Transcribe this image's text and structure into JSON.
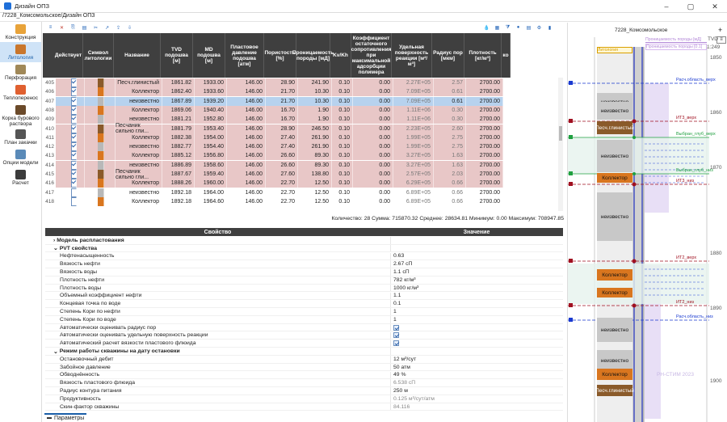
{
  "window": {
    "title": "Дизайн ОПЗ",
    "breadcrumb": "/7228_Комсомольское/Дизайн ОПЗ"
  },
  "sidebar": {
    "items": [
      {
        "label": "Конструкция",
        "icon": "construction-icon",
        "color": "#e8a33a"
      },
      {
        "label": "Литология",
        "icon": "lithology-icon",
        "color": "#c9762c",
        "active": true
      },
      {
        "label": "Перфорация",
        "icon": "perforation-icon",
        "color": "#a08858"
      },
      {
        "label": "Теплоперенос",
        "icon": "heat-transfer-icon",
        "color": "#e06030"
      },
      {
        "label": "Корка бурового раствора",
        "icon": "mud-cake-icon",
        "color": "#6b4a2a"
      },
      {
        "label": "План закачки",
        "icon": "injection-plan-icon",
        "color": "#555555"
      },
      {
        "label": "Опции модели",
        "icon": "model-options-icon",
        "color": "#5a8ab8"
      },
      {
        "label": "Расчет",
        "icon": "calculate-icon",
        "color": "#3c3c3c"
      }
    ]
  },
  "grid": {
    "columns": [
      "Действует",
      "Символ литологии",
      "Название",
      "TVD подошва [м]",
      "MD подошва [м]",
      "Пластовое давление подошва [атм]",
      "Пористость [%]",
      "Проницаемость породы [мД]",
      "Kv/Kh",
      "Коэффициент остаточного сопротивления при максимальной адсорбции полимера",
      "Удельная поверхность реакции [м²/м³]",
      "Радиус пор [мкм]",
      "Плотность [кг/м³]",
      "ко"
    ],
    "rows": [
      {
        "no": "405",
        "on": true,
        "sym": "#8a5a2a",
        "name": "Песч.глинистый",
        "tvd": "1861.82",
        "md": "1933.00",
        "p": "146.00",
        "por": "28.90",
        "perm": "241.90",
        "kv": "0.10",
        "koef": "0.00",
        "surf": "2.27E+05",
        "r": "2.57",
        "rdim": true,
        "dens": "2700.00",
        "bg": "#e8c7c7"
      },
      {
        "no": "406",
        "on": true,
        "sym": "#d9761f",
        "name": "Коллектор",
        "tvd": "1862.40",
        "md": "1933.60",
        "p": "146.00",
        "por": "21.70",
        "perm": "10.30",
        "kv": "0.10",
        "koef": "0.00",
        "surf": "7.09E+05",
        "r": "0.61",
        "rdim": true,
        "dens": "2700.00",
        "bg": "#e8c7c7"
      },
      {
        "no": "407",
        "on": true,
        "sym": "#b8b8b8",
        "name": "неизвестно",
        "tvd": "1867.89",
        "md": "1939.20",
        "p": "146.00",
        "por": "21.70",
        "perm": "10.30",
        "kv": "0.10",
        "koef": "0.00",
        "surf": "7.09E+05",
        "r": "0.61",
        "rdim": false,
        "dens": "2700.00",
        "bg": "#b7d2ee",
        "sel": true
      },
      {
        "no": "408",
        "on": true,
        "sym": "#d9761f",
        "name": "Коллектор",
        "tvd": "1869.06",
        "md": "1940.40",
        "p": "146.00",
        "por": "16.70",
        "perm": "1.90",
        "kv": "0.10",
        "koef": "0.00",
        "surf": "1.11E+06",
        "r": "0.30",
        "rdim": true,
        "dens": "2700.00",
        "bg": "#e8c7c7"
      },
      {
        "no": "409",
        "on": true,
        "sym": "#b8b8b8",
        "name": "неизвестно",
        "tvd": "1881.21",
        "md": "1952.80",
        "p": "146.00",
        "por": "16.70",
        "perm": "1.90",
        "kv": "0.10",
        "koef": "0.00",
        "surf": "1.11E+06",
        "r": "0.30",
        "rdim": true,
        "dens": "2700.00",
        "bg": "#e8c7c7"
      },
      {
        "no": "410",
        "on": true,
        "sym": "#8a5a2a",
        "name": "Песчаник сильно гли...",
        "tvd": "1881.79",
        "md": "1953.40",
        "p": "146.00",
        "por": "28.90",
        "perm": "246.50",
        "kv": "0.10",
        "koef": "0.00",
        "surf": "2.23E+05",
        "r": "2.60",
        "rdim": true,
        "dens": "2700.00",
        "bg": "#e8c7c7"
      },
      {
        "no": "411",
        "on": true,
        "sym": "#d9761f",
        "name": "Коллектор",
        "tvd": "1882.38",
        "md": "1954.00",
        "p": "146.00",
        "por": "27.40",
        "perm": "261.90",
        "kv": "0.10",
        "koef": "0.00",
        "surf": "1.99E+05",
        "r": "2.75",
        "rdim": true,
        "dens": "2700.00",
        "bg": "#e8c7c7"
      },
      {
        "no": "412",
        "on": true,
        "sym": "#b8b8b8",
        "name": "неизвестно",
        "tvd": "1882.77",
        "md": "1954.40",
        "p": "146.00",
        "por": "27.40",
        "perm": "261.90",
        "kv": "0.10",
        "koef": "0.00",
        "surf": "1.99E+05",
        "r": "2.75",
        "rdim": true,
        "dens": "2700.00",
        "bg": "#e8c7c7"
      },
      {
        "no": "413",
        "on": true,
        "sym": "#d9761f",
        "name": "Коллектор",
        "tvd": "1885.12",
        "md": "1956.80",
        "p": "146.00",
        "por": "26.60",
        "perm": "89.30",
        "kv": "0.10",
        "koef": "0.00",
        "surf": "3.27E+05",
        "r": "1.63",
        "rdim": true,
        "dens": "2700.00",
        "bg": "#e8c7c7"
      },
      {
        "no": "414",
        "on": true,
        "sym": "#b8b8b8",
        "name": "неизвестно",
        "tvd": "1886.89",
        "md": "1958.60",
        "p": "146.00",
        "por": "26.60",
        "perm": "89.30",
        "kv": "0.10",
        "koef": "0.00",
        "surf": "3.27E+05",
        "r": "1.63",
        "rdim": true,
        "dens": "2700.00",
        "bg": "#e8c7c7"
      },
      {
        "no": "415",
        "on": true,
        "sym": "#8a5a2a",
        "name": "Песчаник сильно гли...",
        "tvd": "1887.67",
        "md": "1959.40",
        "p": "146.00",
        "por": "27.60",
        "perm": "138.80",
        "kv": "0.10",
        "koef": "0.00",
        "surf": "2.57E+05",
        "r": "2.03",
        "rdim": true,
        "dens": "2700.00",
        "bg": "#e8c7c7"
      },
      {
        "no": "416",
        "on": true,
        "sym": "#d9761f",
        "name": "Коллектор",
        "tvd": "1888.26",
        "md": "1960.00",
        "p": "146.00",
        "por": "22.70",
        "perm": "12.50",
        "kv": "0.10",
        "koef": "0.00",
        "surf": "6.29E+05",
        "r": "0.66",
        "rdim": true,
        "dens": "2700.00",
        "bg": "#e8c7c7"
      },
      {
        "no": "417",
        "on": false,
        "sym": "#b8b8b8",
        "name": "неизвестно",
        "tvd": "1892.18",
        "md": "1964.00",
        "p": "146.00",
        "por": "22.70",
        "perm": "12.50",
        "kv": "0.10",
        "koef": "0.00",
        "surf": "6.89E+05",
        "r": "0.66",
        "rdim": true,
        "dens": "2700.00",
        "bg": "#ffffff"
      },
      {
        "no": "418",
        "on": false,
        "sym": "#d9761f",
        "name": "Коллектор",
        "tvd": "1892.18",
        "md": "1964.60",
        "p": "146.00",
        "por": "22.70",
        "perm": "12.50",
        "kv": "0.10",
        "koef": "0.00",
        "surf": "6.89E+05",
        "r": "0.66",
        "rdim": true,
        "dens": "2700.00",
        "bg": "#ffffff"
      }
    ]
  },
  "status": "Количество: 28 Сумма: 715870.32 Среднее: 28634.81 Минимум: 0.00 Максимум: 708947.85",
  "props": {
    "headers": [
      "Свойство",
      "Значение"
    ],
    "rows": [
      {
        "k": "Модель распластования",
        "v": "",
        "group": true,
        "collapsed": true
      },
      {
        "k": "PVT свойства",
        "v": "",
        "group": true
      },
      {
        "k": "Нефтенасыщенность",
        "v": "0.63"
      },
      {
        "k": "Вязкость нефти",
        "v": "2.67 сП"
      },
      {
        "k": "Вязкость воды",
        "v": "1.1 сП"
      },
      {
        "k": "Плотность нефти",
        "v": "782 кг/м³"
      },
      {
        "k": "Плотность воды",
        "v": "1000 кг/м³"
      },
      {
        "k": "Объемный коэффициент нефти",
        "v": "1.1"
      },
      {
        "k": "Концевая точка по воде",
        "v": "0.1"
      },
      {
        "k": "Степень Кори по нефти",
        "v": "1"
      },
      {
        "k": "Степень Кори по воде",
        "v": "1"
      },
      {
        "k": "Автоматически оценивать радиус пор",
        "v": "",
        "check": true
      },
      {
        "k": "Автоматически оценивать удельную поверхность реакции",
        "v": "",
        "check": true
      },
      {
        "k": "Автоматический расчет вязкости пластового флюида",
        "v": "",
        "check": true
      },
      {
        "k": "Режим работы скважины на дату остановки",
        "v": "",
        "group": true
      },
      {
        "k": "Остановочный дебит",
        "v": "12 м³/сут"
      },
      {
        "k": "Забойное давление",
        "v": "50 атм"
      },
      {
        "k": "Обводнённость",
        "v": "49 %"
      },
      {
        "k": "Вязкость пластового флюида",
        "v": "6.538 сП",
        "dim": true
      },
      {
        "k": "Радиус контура питания",
        "v": "250 м"
      },
      {
        "k": "Продуктивность",
        "v": "0.125 м³/сут/атм",
        "dim": true
      },
      {
        "k": "Скин-фактор скважины",
        "v": "84.116",
        "dim": true
      }
    ]
  },
  "params_tab": "Параметры",
  "track": {
    "well": "7228_Комсомольское",
    "tvd_label": "TVD",
    "scale": "1:249",
    "legend1": "Проницаемость породы [мД]",
    "legend2": "Проницаемость породы [0.1]",
    "legend3": "Литология",
    "depths": [
      "1850",
      "1860",
      "1870",
      "1880",
      "1890",
      "1900"
    ],
    "markers": [
      "Расч.область_верх",
      "ИТ3_верх",
      "Выбран_глуб_верх",
      "Выбран_глуб_низ",
      "ИТ3_низ",
      "ИТ2_верх",
      "ИТ2_низ",
      "Расч.область_низ"
    ],
    "lith": [
      {
        "label": "неизвестно",
        "color": "#c8c8c8"
      },
      {
        "label": "неизвестно",
        "color": "#c8c8c8"
      },
      {
        "label": "Песч.глинистый",
        "color": "#8a5a2a"
      },
      {
        "label": "неизвестно",
        "color": "#c8c8c8"
      },
      {
        "label": "Коллектор",
        "color": "#d9761f"
      },
      {
        "label": "неизвестно",
        "color": "#c8c8c8"
      },
      {
        "label": "Коллектор",
        "color": "#d9761f"
      },
      {
        "label": "Коллектор",
        "color": "#d9761f"
      },
      {
        "label": "неизвестно",
        "color": "#c8c8c8"
      },
      {
        "label": "неизвестно",
        "color": "#c8c8c8"
      },
      {
        "label": "Коллектор",
        "color": "#d9761f"
      },
      {
        "label": "Песч.глинистый",
        "color": "#8a5a2a"
      }
    ],
    "watermark": "РН-СТИМ 2023"
  }
}
